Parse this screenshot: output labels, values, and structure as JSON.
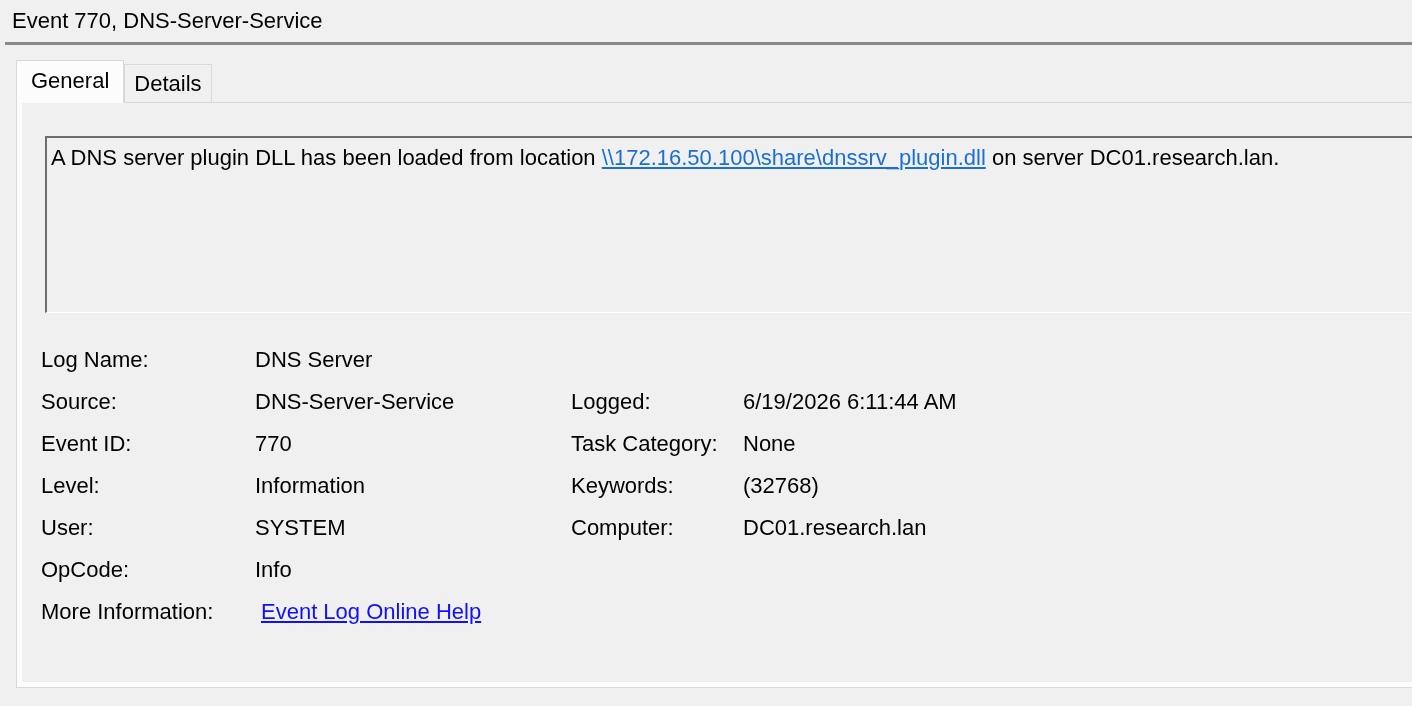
{
  "pane": {
    "title": "Event 770, DNS-Server-Service"
  },
  "tabs": [
    {
      "label": "General",
      "selected": true
    },
    {
      "label": "Details",
      "selected": false
    }
  ],
  "description": {
    "parts": [
      {
        "kind": "text",
        "text": "A DNS server plugin DLL has been loaded from location "
      },
      {
        "kind": "link",
        "text": "\\\\172.16.50.100\\share\\dnssrv_plugin.dll"
      },
      {
        "kind": "text",
        "text": " on server DC01.research.lan."
      }
    ]
  },
  "properties": [
    {
      "label": "Log Name:",
      "value": "DNS Server"
    },
    {
      "label": "Source:",
      "value": "DNS-Server-Service",
      "label_2": "Logged:",
      "value_2": "6/19/2026 6:11:44 AM"
    },
    {
      "label": "Event ID:",
      "value": "770",
      "label_2": "Task Category:",
      "value_2": "None"
    },
    {
      "label": "Level:",
      "value": "Information",
      "label_2": "Keywords:",
      "value_2": "(32768)"
    },
    {
      "label": "User:",
      "value": "SYSTEM",
      "label_2": "Computer:",
      "value_2": "DC01.research.lan"
    },
    {
      "label": "OpCode:",
      "value": "Info"
    },
    {
      "label": "More Information:",
      "link": "Event Log Online Help"
    }
  ]
}
